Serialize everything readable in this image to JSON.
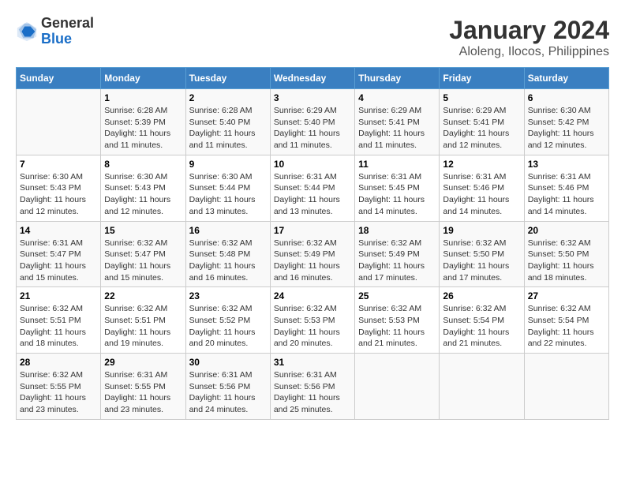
{
  "logo": {
    "line1": "General",
    "line2": "Blue"
  },
  "title": "January 2024",
  "subtitle": "Aloleng, Ilocos, Philippines",
  "days_of_week": [
    "Sunday",
    "Monday",
    "Tuesday",
    "Wednesday",
    "Thursday",
    "Friday",
    "Saturday"
  ],
  "weeks": [
    [
      {
        "num": "",
        "sunrise": "",
        "sunset": "",
        "daylight": ""
      },
      {
        "num": "1",
        "sunrise": "Sunrise: 6:28 AM",
        "sunset": "Sunset: 5:39 PM",
        "daylight": "Daylight: 11 hours and 11 minutes."
      },
      {
        "num": "2",
        "sunrise": "Sunrise: 6:28 AM",
        "sunset": "Sunset: 5:40 PM",
        "daylight": "Daylight: 11 hours and 11 minutes."
      },
      {
        "num": "3",
        "sunrise": "Sunrise: 6:29 AM",
        "sunset": "Sunset: 5:40 PM",
        "daylight": "Daylight: 11 hours and 11 minutes."
      },
      {
        "num": "4",
        "sunrise": "Sunrise: 6:29 AM",
        "sunset": "Sunset: 5:41 PM",
        "daylight": "Daylight: 11 hours and 11 minutes."
      },
      {
        "num": "5",
        "sunrise": "Sunrise: 6:29 AM",
        "sunset": "Sunset: 5:41 PM",
        "daylight": "Daylight: 11 hours and 12 minutes."
      },
      {
        "num": "6",
        "sunrise": "Sunrise: 6:30 AM",
        "sunset": "Sunset: 5:42 PM",
        "daylight": "Daylight: 11 hours and 12 minutes."
      }
    ],
    [
      {
        "num": "7",
        "sunrise": "Sunrise: 6:30 AM",
        "sunset": "Sunset: 5:43 PM",
        "daylight": "Daylight: 11 hours and 12 minutes."
      },
      {
        "num": "8",
        "sunrise": "Sunrise: 6:30 AM",
        "sunset": "Sunset: 5:43 PM",
        "daylight": "Daylight: 11 hours and 12 minutes."
      },
      {
        "num": "9",
        "sunrise": "Sunrise: 6:30 AM",
        "sunset": "Sunset: 5:44 PM",
        "daylight": "Daylight: 11 hours and 13 minutes."
      },
      {
        "num": "10",
        "sunrise": "Sunrise: 6:31 AM",
        "sunset": "Sunset: 5:44 PM",
        "daylight": "Daylight: 11 hours and 13 minutes."
      },
      {
        "num": "11",
        "sunrise": "Sunrise: 6:31 AM",
        "sunset": "Sunset: 5:45 PM",
        "daylight": "Daylight: 11 hours and 14 minutes."
      },
      {
        "num": "12",
        "sunrise": "Sunrise: 6:31 AM",
        "sunset": "Sunset: 5:46 PM",
        "daylight": "Daylight: 11 hours and 14 minutes."
      },
      {
        "num": "13",
        "sunrise": "Sunrise: 6:31 AM",
        "sunset": "Sunset: 5:46 PM",
        "daylight": "Daylight: 11 hours and 14 minutes."
      }
    ],
    [
      {
        "num": "14",
        "sunrise": "Sunrise: 6:31 AM",
        "sunset": "Sunset: 5:47 PM",
        "daylight": "Daylight: 11 hours and 15 minutes."
      },
      {
        "num": "15",
        "sunrise": "Sunrise: 6:32 AM",
        "sunset": "Sunset: 5:47 PM",
        "daylight": "Daylight: 11 hours and 15 minutes."
      },
      {
        "num": "16",
        "sunrise": "Sunrise: 6:32 AM",
        "sunset": "Sunset: 5:48 PM",
        "daylight": "Daylight: 11 hours and 16 minutes."
      },
      {
        "num": "17",
        "sunrise": "Sunrise: 6:32 AM",
        "sunset": "Sunset: 5:49 PM",
        "daylight": "Daylight: 11 hours and 16 minutes."
      },
      {
        "num": "18",
        "sunrise": "Sunrise: 6:32 AM",
        "sunset": "Sunset: 5:49 PM",
        "daylight": "Daylight: 11 hours and 17 minutes."
      },
      {
        "num": "19",
        "sunrise": "Sunrise: 6:32 AM",
        "sunset": "Sunset: 5:50 PM",
        "daylight": "Daylight: 11 hours and 17 minutes."
      },
      {
        "num": "20",
        "sunrise": "Sunrise: 6:32 AM",
        "sunset": "Sunset: 5:50 PM",
        "daylight": "Daylight: 11 hours and 18 minutes."
      }
    ],
    [
      {
        "num": "21",
        "sunrise": "Sunrise: 6:32 AM",
        "sunset": "Sunset: 5:51 PM",
        "daylight": "Daylight: 11 hours and 18 minutes."
      },
      {
        "num": "22",
        "sunrise": "Sunrise: 6:32 AM",
        "sunset": "Sunset: 5:51 PM",
        "daylight": "Daylight: 11 hours and 19 minutes."
      },
      {
        "num": "23",
        "sunrise": "Sunrise: 6:32 AM",
        "sunset": "Sunset: 5:52 PM",
        "daylight": "Daylight: 11 hours and 20 minutes."
      },
      {
        "num": "24",
        "sunrise": "Sunrise: 6:32 AM",
        "sunset": "Sunset: 5:53 PM",
        "daylight": "Daylight: 11 hours and 20 minutes."
      },
      {
        "num": "25",
        "sunrise": "Sunrise: 6:32 AM",
        "sunset": "Sunset: 5:53 PM",
        "daylight": "Daylight: 11 hours and 21 minutes."
      },
      {
        "num": "26",
        "sunrise": "Sunrise: 6:32 AM",
        "sunset": "Sunset: 5:54 PM",
        "daylight": "Daylight: 11 hours and 21 minutes."
      },
      {
        "num": "27",
        "sunrise": "Sunrise: 6:32 AM",
        "sunset": "Sunset: 5:54 PM",
        "daylight": "Daylight: 11 hours and 22 minutes."
      }
    ],
    [
      {
        "num": "28",
        "sunrise": "Sunrise: 6:32 AM",
        "sunset": "Sunset: 5:55 PM",
        "daylight": "Daylight: 11 hours and 23 minutes."
      },
      {
        "num": "29",
        "sunrise": "Sunrise: 6:31 AM",
        "sunset": "Sunset: 5:55 PM",
        "daylight": "Daylight: 11 hours and 23 minutes."
      },
      {
        "num": "30",
        "sunrise": "Sunrise: 6:31 AM",
        "sunset": "Sunset: 5:56 PM",
        "daylight": "Daylight: 11 hours and 24 minutes."
      },
      {
        "num": "31",
        "sunrise": "Sunrise: 6:31 AM",
        "sunset": "Sunset: 5:56 PM",
        "daylight": "Daylight: 11 hours and 25 minutes."
      },
      {
        "num": "",
        "sunrise": "",
        "sunset": "",
        "daylight": ""
      },
      {
        "num": "",
        "sunrise": "",
        "sunset": "",
        "daylight": ""
      },
      {
        "num": "",
        "sunrise": "",
        "sunset": "",
        "daylight": ""
      }
    ]
  ]
}
